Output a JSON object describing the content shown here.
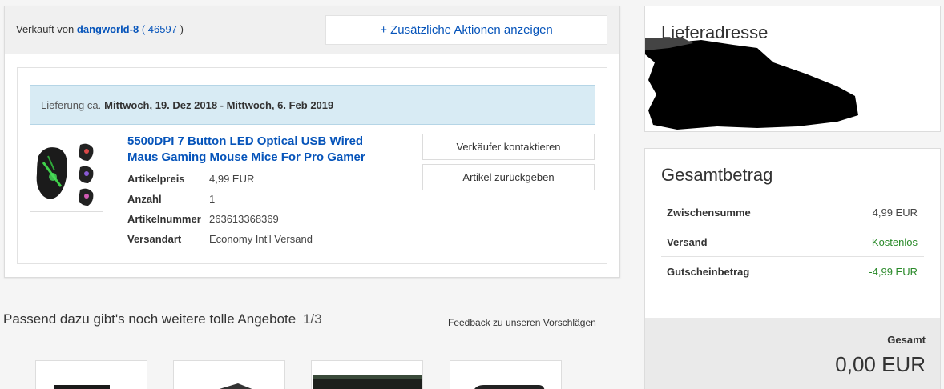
{
  "order": {
    "sold_by_label": "Verkauft von",
    "seller_name": "dangworld-8",
    "feedback_open": "(",
    "feedback_count": "46597",
    "feedback_close": ")",
    "more_actions_label": "+ Zusätzliche Aktionen anzeigen",
    "delivery_prefix": "Lieferung ca.",
    "delivery_range": "Mittwoch, 19. Dez 2018 - Mittwoch, 6. Feb 2019",
    "item": {
      "title": "5500DPI 7 Button LED Optical USB Wired Maus Gaming Mouse Mice For Pro Gamer",
      "specs": [
        {
          "label": "Artikelpreis",
          "value": "4,99 EUR"
        },
        {
          "label": "Anzahl",
          "value": "1"
        },
        {
          "label": "Artikelnummer",
          "value": "263613368369"
        },
        {
          "label": "Versandart",
          "value": "Economy Int'l Versand"
        }
      ]
    },
    "contact_seller_label": "Verkäufer kontaktieren",
    "return_item_label": "Artikel zurückgeben"
  },
  "recommendations": {
    "title": "Passend dazu gibt's noch weitere tolle Angebote",
    "pager": "1/3",
    "feedback_link": "Feedback zu unseren Vorschlägen"
  },
  "address": {
    "title": "Lieferadresse"
  },
  "summary": {
    "title": "Gesamtbetrag",
    "rows": [
      {
        "label": "Zwischensumme",
        "value": "4,99 EUR"
      },
      {
        "label": "Versand",
        "value": "Kostenlos"
      },
      {
        "label": "Gutscheinbetrag",
        "value": "-4,99 EUR"
      }
    ],
    "total_label": "Gesamt",
    "total_value": "0,00 EUR"
  },
  "colors": {
    "link": "#0654ba",
    "green": "#2a8a2a",
    "delivery_bg": "#d8ebf4"
  }
}
